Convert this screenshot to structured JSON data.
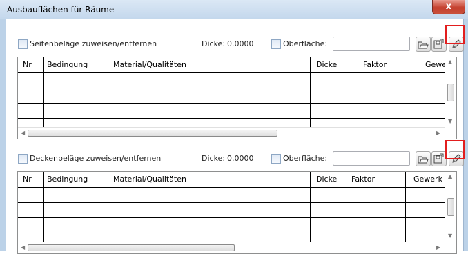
{
  "window": {
    "title": "Ausbauflächen für Räume",
    "close_glyph": "x"
  },
  "columns": [
    "Nr",
    "Bedingung",
    "Material/Qualitäten",
    "Dicke",
    "Faktor",
    "Gewerk"
  ],
  "wall_section": {
    "assign_label": "Seitenbeläge zuweisen/entfernen",
    "dicke_label": "Dicke:",
    "dicke_value": "0.0000",
    "surface_label": "Oberfläche:",
    "surface_value": ""
  },
  "ceiling_section": {
    "assign_label": "Deckenbeläge zuweisen/entfernen",
    "dicke_label": "Dicke:",
    "dicke_value": "0.0000",
    "surface_label": "Oberfläche:",
    "surface_value": ""
  },
  "icons": {
    "open": "folder-open-icon",
    "save": "save-icon",
    "edit": "pencil-icon"
  },
  "colors": {
    "highlight": "#e21e1e",
    "close_button": "#c4402e",
    "titlebar": "#c3d7ec"
  }
}
